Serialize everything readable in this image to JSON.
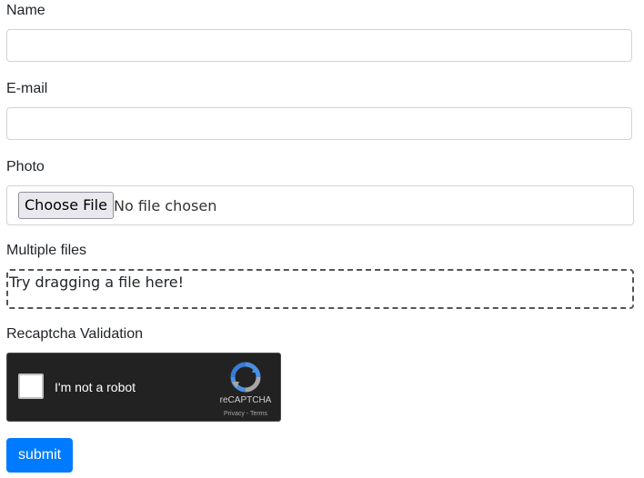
{
  "form": {
    "name": {
      "label": "Name",
      "value": "",
      "placeholder": ""
    },
    "email": {
      "label": "E-mail",
      "value": "",
      "placeholder": ""
    },
    "photo": {
      "label": "Photo",
      "button_label": "Choose File",
      "status": "No file chosen"
    },
    "multiple_files": {
      "label": "Multiple files",
      "dropzone_text": "Try dragging a file here!"
    },
    "recaptcha": {
      "label": "Recaptcha Validation",
      "checkbox_label": "I'm not a robot",
      "brand": "reCAPTCHA",
      "privacy_link": "Privacy",
      "separator": " - ",
      "terms_link": "Terms",
      "logo_icon": "recaptcha-logo-icon",
      "colors": {
        "widget_bg": "#222222",
        "logo_blue": "#4a90e2",
        "logo_gray": "#a6a6a6"
      }
    },
    "submit": {
      "label": "submit",
      "color": "#007bff"
    }
  }
}
